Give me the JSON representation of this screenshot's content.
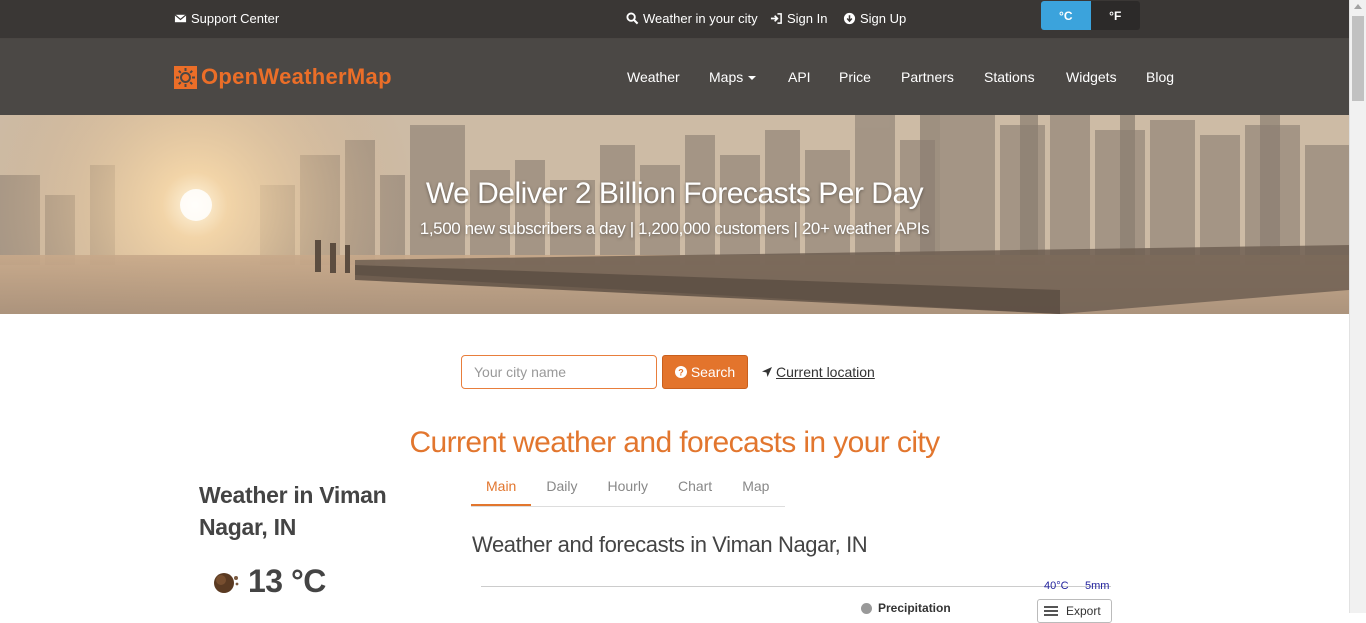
{
  "topbar": {
    "support_label": "Support Center",
    "weather_city_label": "Weather in your city",
    "sign_in_label": "Sign In",
    "sign_up_label": "Sign Up",
    "unit_c": "°C",
    "unit_f": "°F",
    "active_unit": "°C"
  },
  "nav": {
    "logo_text": "OpenWeatherMap",
    "items": [
      {
        "label": "Weather"
      },
      {
        "label": "Maps"
      },
      {
        "label": "API"
      },
      {
        "label": "Price"
      },
      {
        "label": "Partners"
      },
      {
        "label": "Stations"
      },
      {
        "label": "Widgets"
      },
      {
        "label": "Blog"
      }
    ]
  },
  "hero": {
    "title": "We Deliver 2 Billion Forecasts Per Day",
    "subtitle": "1,500 new subscribers a day | 1,200,000 customers | 20+ weather APIs"
  },
  "search": {
    "placeholder": "Your city name",
    "button_label": "Search",
    "current_location_label": "Current location"
  },
  "main": {
    "section_title": "Current weather and forecasts in your city",
    "city_title": "Weather in Viman Nagar, IN",
    "temperature": "13 °C",
    "tabs": [
      {
        "label": "Main"
      },
      {
        "label": "Daily"
      },
      {
        "label": "Hourly"
      },
      {
        "label": "Chart"
      },
      {
        "label": "Map"
      }
    ],
    "active_tab": "Main",
    "forecast_title": "Weather and forecasts in Viman Nagar, IN",
    "chart_axis_temp": "40°C",
    "chart_axis_precip": "5mm",
    "legend_precipitation": "Precipitation",
    "export_label": "Export"
  },
  "colors": {
    "accent": "#e2762e",
    "topbar_bg": "#3a3735",
    "navbar_bg": "#4b4845",
    "unit_active": "#3ba3dc"
  }
}
